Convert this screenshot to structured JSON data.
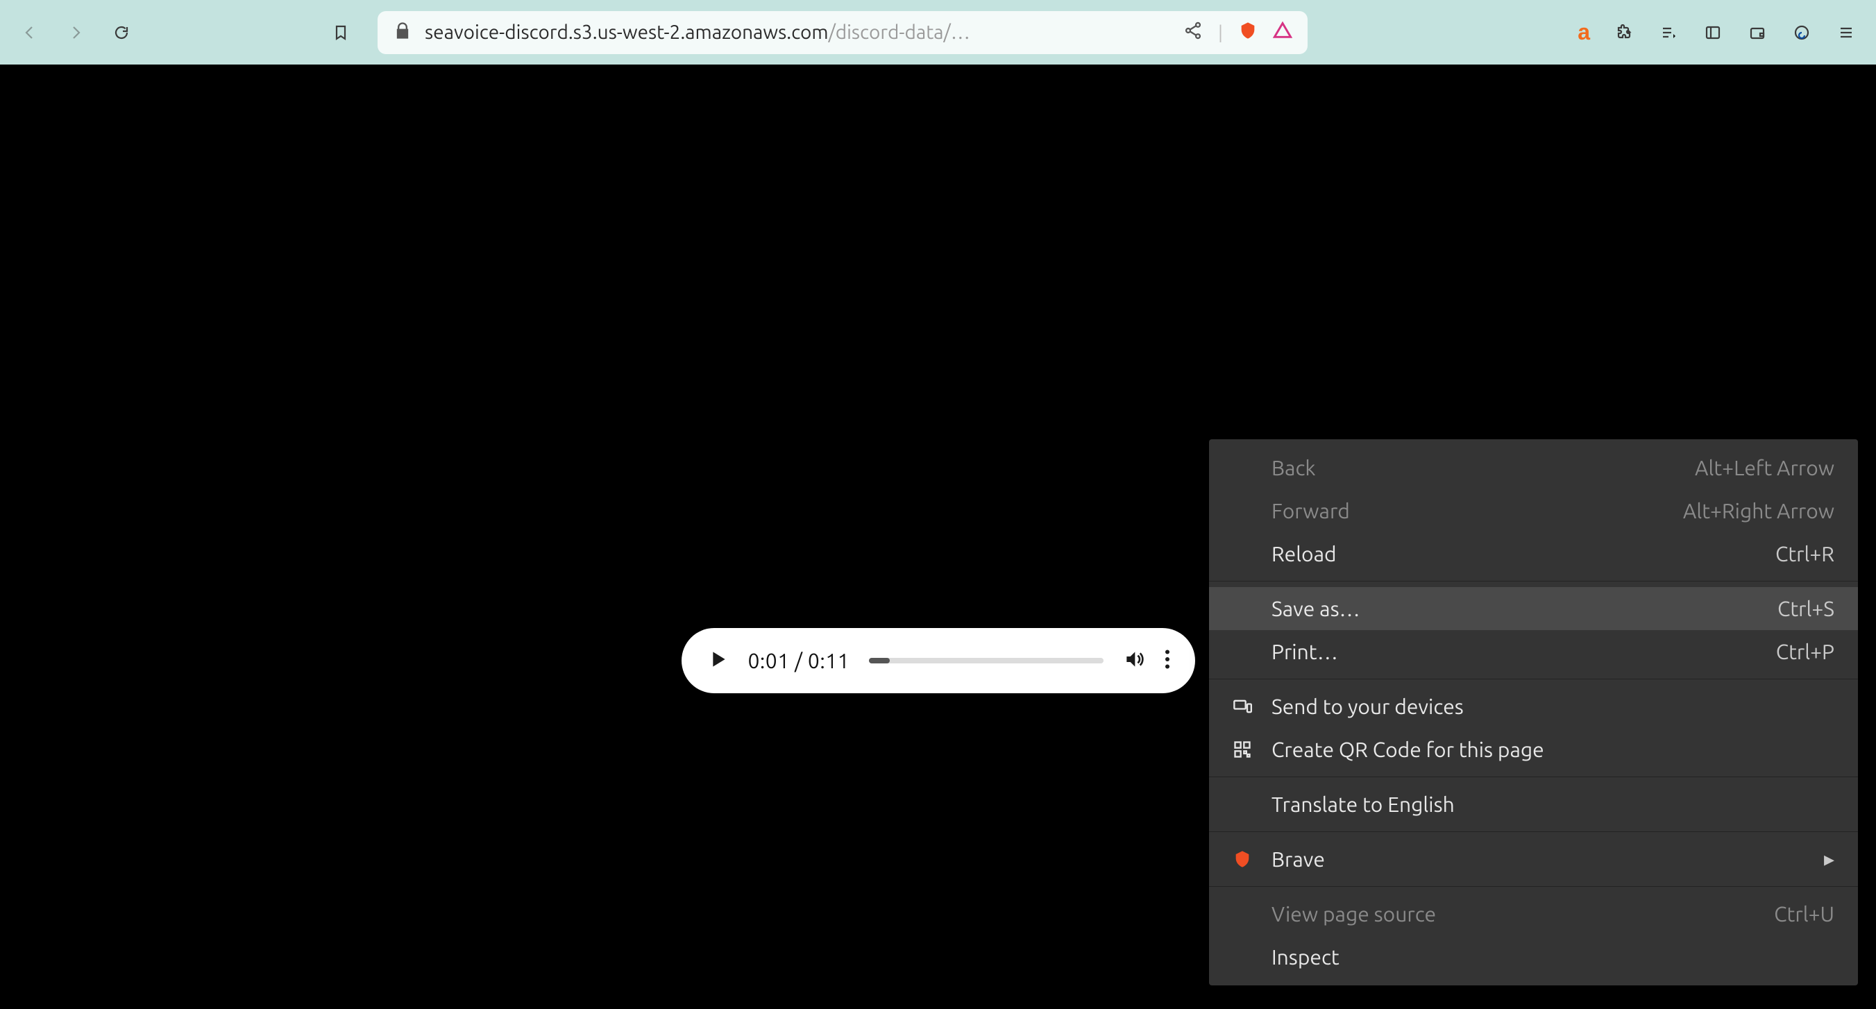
{
  "toolbar": {
    "url_host": "seavoice-discord.s3.us-west-2.amazonaws.com",
    "url_path": "/discord-data/…",
    "back_enabled": false,
    "forward_enabled": false
  },
  "audio": {
    "current_time": "0:01",
    "duration": "0:11",
    "time_display": "0:01 / 0:11"
  },
  "context_menu": {
    "items": [
      {
        "label": "Back",
        "shortcut": "Alt+Left Arrow",
        "enabled": false,
        "icon": ""
      },
      {
        "label": "Forward",
        "shortcut": "Alt+Right Arrow",
        "enabled": false,
        "icon": ""
      },
      {
        "label": "Reload",
        "shortcut": "Ctrl+R",
        "enabled": true,
        "icon": ""
      },
      {
        "separator": true
      },
      {
        "label": "Save as…",
        "shortcut": "Ctrl+S",
        "enabled": true,
        "icon": "",
        "highlighted": true
      },
      {
        "label": "Print…",
        "shortcut": "Ctrl+P",
        "enabled": true,
        "icon": ""
      },
      {
        "separator": true
      },
      {
        "label": "Send to your devices",
        "shortcut": "",
        "enabled": true,
        "icon": "devices"
      },
      {
        "label": "Create QR Code for this page",
        "shortcut": "",
        "enabled": true,
        "icon": "qr"
      },
      {
        "separator": true
      },
      {
        "label": "Translate to English",
        "shortcut": "",
        "enabled": true,
        "icon": ""
      },
      {
        "separator": true
      },
      {
        "label": "Brave",
        "shortcut": "",
        "enabled": true,
        "icon": "brave",
        "submenu": true
      },
      {
        "separator": true
      },
      {
        "label": "View page source",
        "shortcut": "Ctrl+U",
        "enabled": false,
        "icon": ""
      },
      {
        "label": "Inspect",
        "shortcut": "",
        "enabled": true,
        "icon": ""
      }
    ]
  }
}
